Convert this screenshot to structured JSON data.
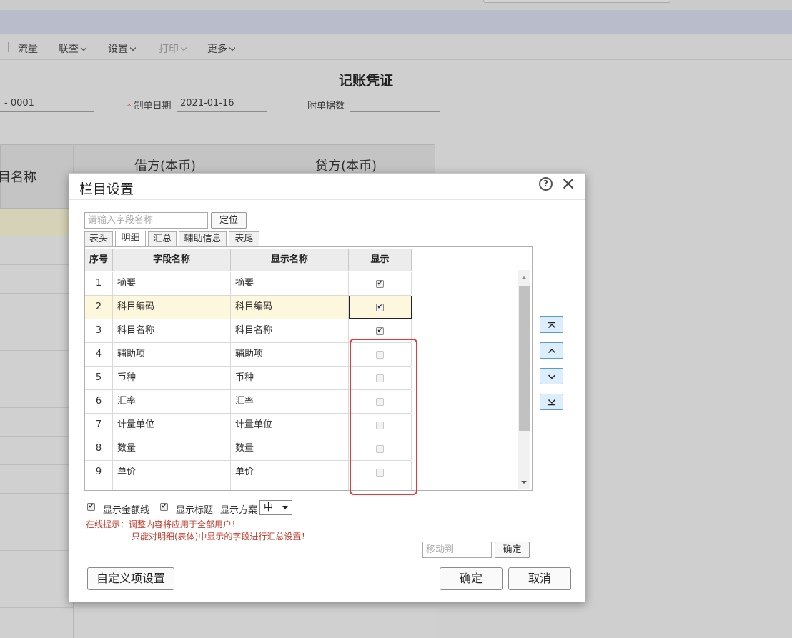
{
  "toolbar": {
    "items": [
      {
        "label": "流量"
      },
      {
        "label": "联查"
      },
      {
        "label": "设置"
      },
      {
        "label": "打印"
      },
      {
        "label": "更多"
      }
    ]
  },
  "voucher": {
    "title": "记账凭证",
    "number_value": "- 0001",
    "date_label": "制单日期",
    "date_value": "2021-01-16",
    "attachments_label": "附单据数",
    "required_mark": "*",
    "col_subject": "目名称",
    "col_debit": "借方(本币)",
    "col_credit": "贷方(本币)"
  },
  "dialog": {
    "title": "栏目设置",
    "search_placeholder": "请输入字段名称",
    "locate_btn": "定位",
    "tabs": [
      {
        "label": "表头"
      },
      {
        "label": "明细"
      },
      {
        "label": "汇总"
      },
      {
        "label": "辅助信息"
      },
      {
        "label": "表尾"
      }
    ],
    "active_tab": "明细",
    "table": {
      "headers": [
        "序号",
        "字段名称",
        "显示名称",
        "显示"
      ],
      "rows": [
        {
          "index": "1",
          "field": "摘要",
          "display": "摘要",
          "shown": true
        },
        {
          "index": "2",
          "field": "科目编码",
          "display": "科目编码",
          "shown": true
        },
        {
          "index": "3",
          "field": "科目名称",
          "display": "科目名称",
          "shown": true
        },
        {
          "index": "4",
          "field": "辅助项",
          "display": "辅助项",
          "shown": false
        },
        {
          "index": "5",
          "field": "币种",
          "display": "币种",
          "shown": false
        },
        {
          "index": "6",
          "field": "汇率",
          "display": "汇率",
          "shown": false
        },
        {
          "index": "7",
          "field": "计量单位",
          "display": "计量单位",
          "shown": false
        },
        {
          "index": "8",
          "field": "数量",
          "display": "数量",
          "shown": false
        },
        {
          "index": "9",
          "field": "单价",
          "display": "单价",
          "shown": false
        }
      ]
    },
    "options": {
      "show_amount_lines": "显示金额线",
      "show_title": "显示标题",
      "display_scheme_label": "显示方案",
      "display_scheme_value": "中"
    },
    "tip_line1": "在线提示：调整内容将应用于全部用户！",
    "tip_line2": "只能对明细(表体)中显示的字段进行汇总设置！",
    "move_placeholder": "移动到",
    "move_confirm": "确定",
    "custom_btn": "自定义项设置",
    "ok_btn": "确定",
    "cancel_btn": "取消"
  },
  "colors": {
    "highlight_row": "#fdf7dd",
    "annotation_red": "#e53935",
    "move_btn_bg": "#dceefb",
    "tip_red": "#c0392b"
  }
}
